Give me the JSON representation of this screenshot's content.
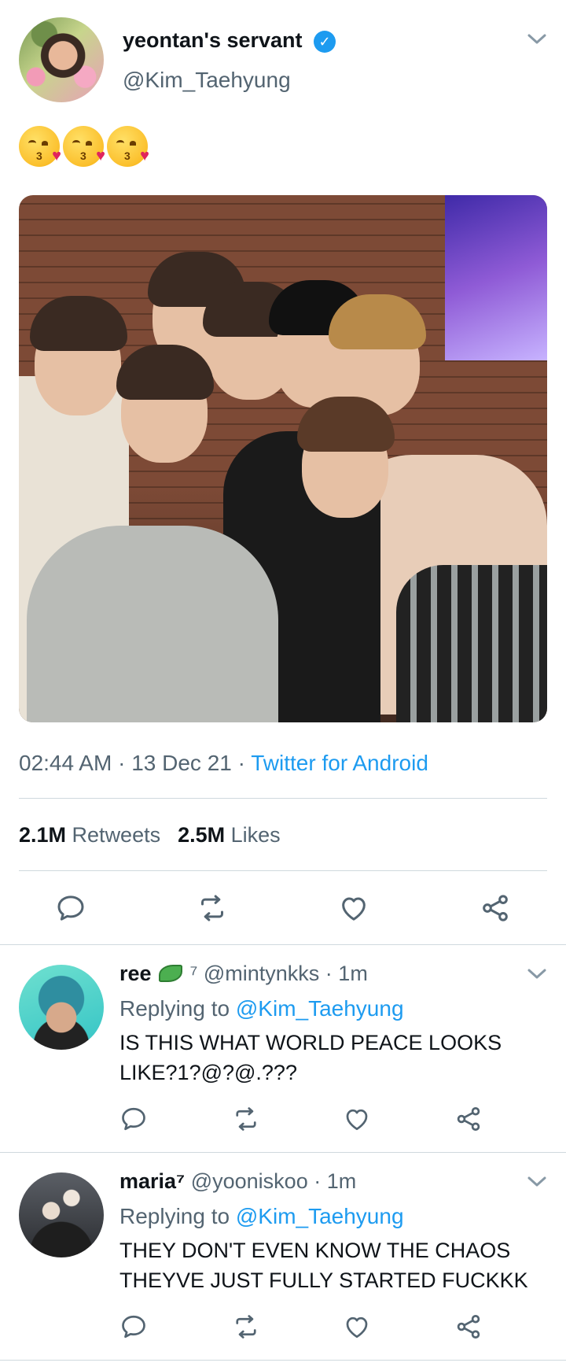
{
  "tweet": {
    "display_name": "yeontan's servant",
    "verified_mark": "✓",
    "handle": "@Kim_Taehyung",
    "emojis": [
      "kissing-face-heart-emoji",
      "kissing-face-heart-emoji",
      "kissing-face-heart-emoji"
    ],
    "time": "02:44 AM",
    "sep1": " · ",
    "date": "13 Dec 21",
    "sep2": " · ",
    "source": "Twitter for Android",
    "retweets_count": "2.1M",
    "retweets_label": "Retweets",
    "likes_count": "2.5M",
    "likes_label": "Likes",
    "actions": [
      "reply-icon",
      "retweet-icon",
      "like-icon",
      "share-icon"
    ]
  },
  "replies": [
    {
      "name": "ree",
      "name_suffix": " ⁷",
      "handle": "@mintynkks",
      "dot": " · ",
      "time": "1m",
      "replying_prefix": "Replying to ",
      "replying_to": "@Kim_Taehyung",
      "text": "IS THIS WHAT WORLD PEACE LOOKS LIKE?1?@?@.???"
    },
    {
      "name": "maria⁷",
      "name_suffix": "",
      "handle": "@yooniskoo",
      "dot": " · ",
      "time": "1m",
      "replying_prefix": "Replying to ",
      "replying_to": "@Kim_Taehyung",
      "text": "THEY DON'T EVEN KNOW THE CHAOS THEYVE JUST FULLY STARTED FUCKKK"
    }
  ],
  "colors": {
    "accent": "#1d9bf0",
    "secondary_text": "#536471",
    "icon": "#536471",
    "divider": "#cfd9de"
  }
}
